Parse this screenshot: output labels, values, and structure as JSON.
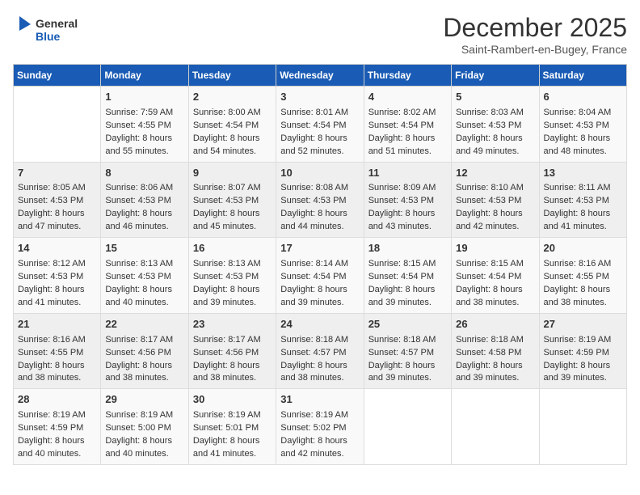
{
  "header": {
    "logo_general": "General",
    "logo_blue": "Blue",
    "month_title": "December 2025",
    "subtitle": "Saint-Rambert-en-Bugey, France"
  },
  "days_of_week": [
    "Sunday",
    "Monday",
    "Tuesday",
    "Wednesday",
    "Thursday",
    "Friday",
    "Saturday"
  ],
  "weeks": [
    [
      {
        "day": "",
        "sunrise": "",
        "sunset": "",
        "daylight": ""
      },
      {
        "day": "1",
        "sunrise": "Sunrise: 7:59 AM",
        "sunset": "Sunset: 4:55 PM",
        "daylight": "Daylight: 8 hours and 55 minutes."
      },
      {
        "day": "2",
        "sunrise": "Sunrise: 8:00 AM",
        "sunset": "Sunset: 4:54 PM",
        "daylight": "Daylight: 8 hours and 54 minutes."
      },
      {
        "day": "3",
        "sunrise": "Sunrise: 8:01 AM",
        "sunset": "Sunset: 4:54 PM",
        "daylight": "Daylight: 8 hours and 52 minutes."
      },
      {
        "day": "4",
        "sunrise": "Sunrise: 8:02 AM",
        "sunset": "Sunset: 4:54 PM",
        "daylight": "Daylight: 8 hours and 51 minutes."
      },
      {
        "day": "5",
        "sunrise": "Sunrise: 8:03 AM",
        "sunset": "Sunset: 4:53 PM",
        "daylight": "Daylight: 8 hours and 49 minutes."
      },
      {
        "day": "6",
        "sunrise": "Sunrise: 8:04 AM",
        "sunset": "Sunset: 4:53 PM",
        "daylight": "Daylight: 8 hours and 48 minutes."
      }
    ],
    [
      {
        "day": "7",
        "sunrise": "Sunrise: 8:05 AM",
        "sunset": "Sunset: 4:53 PM",
        "daylight": "Daylight: 8 hours and 47 minutes."
      },
      {
        "day": "8",
        "sunrise": "Sunrise: 8:06 AM",
        "sunset": "Sunset: 4:53 PM",
        "daylight": "Daylight: 8 hours and 46 minutes."
      },
      {
        "day": "9",
        "sunrise": "Sunrise: 8:07 AM",
        "sunset": "Sunset: 4:53 PM",
        "daylight": "Daylight: 8 hours and 45 minutes."
      },
      {
        "day": "10",
        "sunrise": "Sunrise: 8:08 AM",
        "sunset": "Sunset: 4:53 PM",
        "daylight": "Daylight: 8 hours and 44 minutes."
      },
      {
        "day": "11",
        "sunrise": "Sunrise: 8:09 AM",
        "sunset": "Sunset: 4:53 PM",
        "daylight": "Daylight: 8 hours and 43 minutes."
      },
      {
        "day": "12",
        "sunrise": "Sunrise: 8:10 AM",
        "sunset": "Sunset: 4:53 PM",
        "daylight": "Daylight: 8 hours and 42 minutes."
      },
      {
        "day": "13",
        "sunrise": "Sunrise: 8:11 AM",
        "sunset": "Sunset: 4:53 PM",
        "daylight": "Daylight: 8 hours and 41 minutes."
      }
    ],
    [
      {
        "day": "14",
        "sunrise": "Sunrise: 8:12 AM",
        "sunset": "Sunset: 4:53 PM",
        "daylight": "Daylight: 8 hours and 41 minutes."
      },
      {
        "day": "15",
        "sunrise": "Sunrise: 8:13 AM",
        "sunset": "Sunset: 4:53 PM",
        "daylight": "Daylight: 8 hours and 40 minutes."
      },
      {
        "day": "16",
        "sunrise": "Sunrise: 8:13 AM",
        "sunset": "Sunset: 4:53 PM",
        "daylight": "Daylight: 8 hours and 39 minutes."
      },
      {
        "day": "17",
        "sunrise": "Sunrise: 8:14 AM",
        "sunset": "Sunset: 4:54 PM",
        "daylight": "Daylight: 8 hours and 39 minutes."
      },
      {
        "day": "18",
        "sunrise": "Sunrise: 8:15 AM",
        "sunset": "Sunset: 4:54 PM",
        "daylight": "Daylight: 8 hours and 39 minutes."
      },
      {
        "day": "19",
        "sunrise": "Sunrise: 8:15 AM",
        "sunset": "Sunset: 4:54 PM",
        "daylight": "Daylight: 8 hours and 38 minutes."
      },
      {
        "day": "20",
        "sunrise": "Sunrise: 8:16 AM",
        "sunset": "Sunset: 4:55 PM",
        "daylight": "Daylight: 8 hours and 38 minutes."
      }
    ],
    [
      {
        "day": "21",
        "sunrise": "Sunrise: 8:16 AM",
        "sunset": "Sunset: 4:55 PM",
        "daylight": "Daylight: 8 hours and 38 minutes."
      },
      {
        "day": "22",
        "sunrise": "Sunrise: 8:17 AM",
        "sunset": "Sunset: 4:56 PM",
        "daylight": "Daylight: 8 hours and 38 minutes."
      },
      {
        "day": "23",
        "sunrise": "Sunrise: 8:17 AM",
        "sunset": "Sunset: 4:56 PM",
        "daylight": "Daylight: 8 hours and 38 minutes."
      },
      {
        "day": "24",
        "sunrise": "Sunrise: 8:18 AM",
        "sunset": "Sunset: 4:57 PM",
        "daylight": "Daylight: 8 hours and 38 minutes."
      },
      {
        "day": "25",
        "sunrise": "Sunrise: 8:18 AM",
        "sunset": "Sunset: 4:57 PM",
        "daylight": "Daylight: 8 hours and 39 minutes."
      },
      {
        "day": "26",
        "sunrise": "Sunrise: 8:18 AM",
        "sunset": "Sunset: 4:58 PM",
        "daylight": "Daylight: 8 hours and 39 minutes."
      },
      {
        "day": "27",
        "sunrise": "Sunrise: 8:19 AM",
        "sunset": "Sunset: 4:59 PM",
        "daylight": "Daylight: 8 hours and 39 minutes."
      }
    ],
    [
      {
        "day": "28",
        "sunrise": "Sunrise: 8:19 AM",
        "sunset": "Sunset: 4:59 PM",
        "daylight": "Daylight: 8 hours and 40 minutes."
      },
      {
        "day": "29",
        "sunrise": "Sunrise: 8:19 AM",
        "sunset": "Sunset: 5:00 PM",
        "daylight": "Daylight: 8 hours and 40 minutes."
      },
      {
        "day": "30",
        "sunrise": "Sunrise: 8:19 AM",
        "sunset": "Sunset: 5:01 PM",
        "daylight": "Daylight: 8 hours and 41 minutes."
      },
      {
        "day": "31",
        "sunrise": "Sunrise: 8:19 AM",
        "sunset": "Sunset: 5:02 PM",
        "daylight": "Daylight: 8 hours and 42 minutes."
      },
      {
        "day": "",
        "sunrise": "",
        "sunset": "",
        "daylight": ""
      },
      {
        "day": "",
        "sunrise": "",
        "sunset": "",
        "daylight": ""
      },
      {
        "day": "",
        "sunrise": "",
        "sunset": "",
        "daylight": ""
      }
    ]
  ]
}
